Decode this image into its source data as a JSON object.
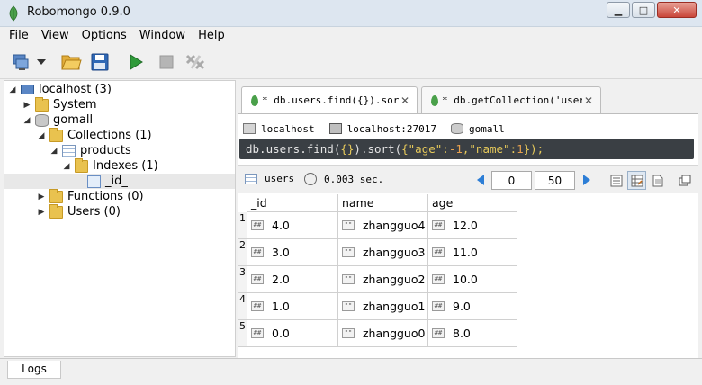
{
  "window": {
    "title": "Robomongo 0.9.0"
  },
  "menu": [
    "File",
    "View",
    "Options",
    "Window",
    "Help"
  ],
  "tree": [
    {
      "label": "localhost (3)",
      "icon": "monitor-icon",
      "expander": "expanded"
    },
    {
      "label": "System",
      "icon": "folder-icon",
      "expander": "collapsed"
    },
    {
      "label": "gomall",
      "icon": "database-icon",
      "expander": "expanded"
    },
    {
      "label": "Collections (1)",
      "icon": "folder-icon",
      "expander": "expanded"
    },
    {
      "label": "products",
      "icon": "table-icon",
      "expander": "expanded"
    },
    {
      "label": "Indexes (1)",
      "icon": "folder-icon",
      "expander": "expanded"
    },
    {
      "label": "_id_",
      "icon": "index-icon",
      "expander": "none"
    },
    {
      "label": "Functions (0)",
      "icon": "folder-icon",
      "expander": "collapsed"
    },
    {
      "label": "Users (0)",
      "icon": "folder-icon",
      "expander": "collapsed"
    }
  ],
  "tabs": [
    {
      "label": "* db.users.find({}).sort…",
      "close": "✕"
    },
    {
      "label": "* db.getCollection('user…",
      "close": "✕"
    }
  ],
  "connection": {
    "host": "localhost",
    "server": "localhost:27017",
    "database": "gomall"
  },
  "query": {
    "prefix": "db.users.find(",
    "arg1": "{}",
    "mid": ").sort(",
    "brace_open": "{",
    "key1": "\"age\"",
    "colon1": ":",
    "val1": "-1",
    "comma": ",",
    "key2": "\"name\"",
    "colon2": ":",
    "val2": "1",
    "end": "});"
  },
  "results_bar": {
    "collection": "users",
    "time": "0.003 sec.",
    "skip": "0",
    "limit": "50"
  },
  "columns": [
    "_id",
    "name",
    "age"
  ],
  "rows": [
    {
      "num": "1",
      "id": "4.0",
      "name": "zhangguo4",
      "age": "12.0"
    },
    {
      "num": "2",
      "id": "3.0",
      "name": "zhangguo3",
      "age": "11.0"
    },
    {
      "num": "3",
      "id": "2.0",
      "name": "zhangguo2",
      "age": "10.0"
    },
    {
      "num": "4",
      "id": "1.0",
      "name": "zhangguo1",
      "age": "9.0"
    },
    {
      "num": "5",
      "id": "0.0",
      "name": "zhangguo0",
      "age": "8.0"
    }
  ],
  "badges": {
    "number": "##",
    "string": "\"\""
  },
  "bottom": {
    "logs_label": "Logs"
  },
  "colors": {
    "accent": "#2d7ed6",
    "query_bg": "#3a3f44",
    "query_string": "#e6c95a",
    "query_number": "#e8a14e",
    "mongo_leaf": "#4aa04a"
  }
}
